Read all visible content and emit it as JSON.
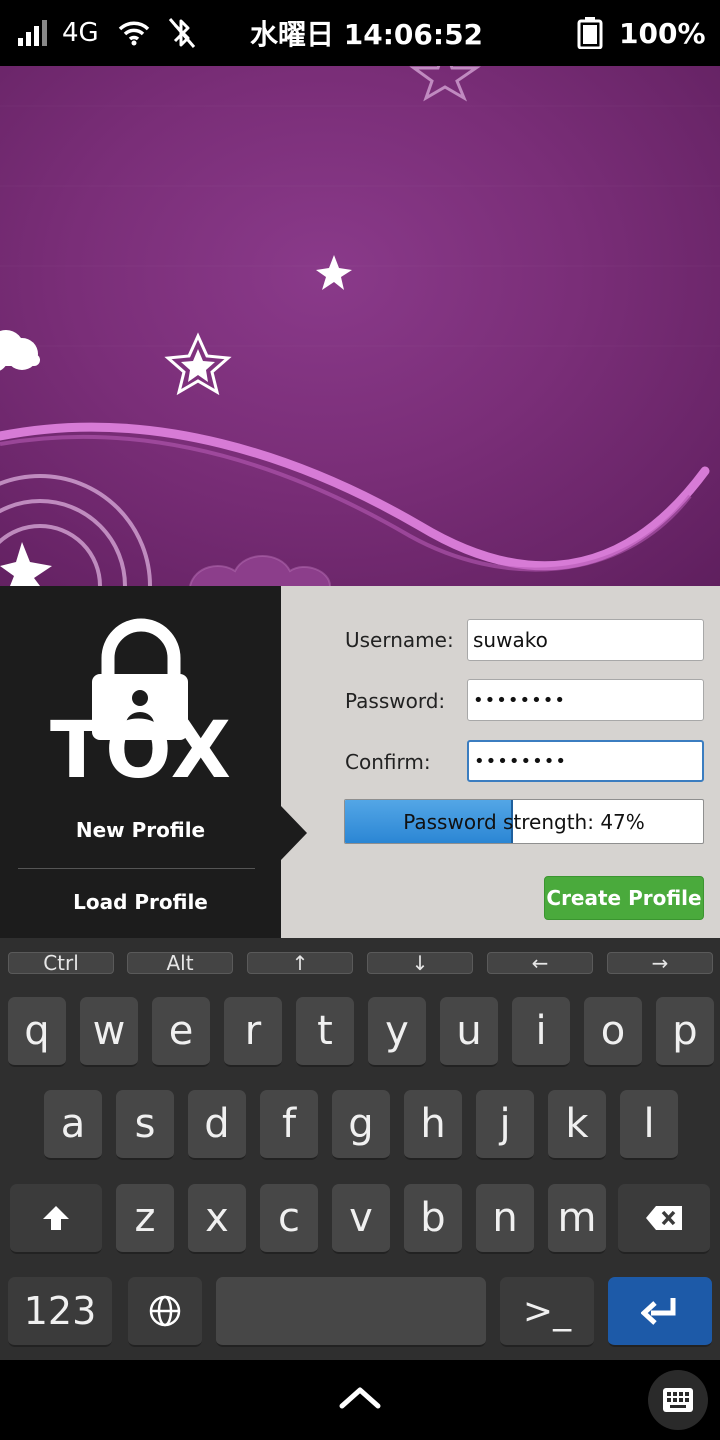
{
  "status_bar": {
    "network": "4G",
    "time": "水曜日 14:06:52",
    "battery": "100%",
    "icons": [
      "signal-icon",
      "wifi-icon",
      "bluetooth-off-icon",
      "battery-icon"
    ]
  },
  "sidebar": {
    "logo_text": "TOX",
    "new_profile": "New Profile",
    "load_profile": "Load Profile"
  },
  "form": {
    "username_label": "Username:",
    "username_value": "suwako",
    "password_label": "Password:",
    "password_value": "••••••••",
    "confirm_label": "Confirm:",
    "confirm_value": "••••••••",
    "strength_text": "Password strength: 47%",
    "strength_percent": 47,
    "create_button": "Create Profile"
  },
  "colors": {
    "accent_blue": "#2b86d4",
    "create_green": "#4aaa3c",
    "wallpaper_purple": "#7a2e78"
  },
  "keyboard": {
    "function_keys": [
      "Ctrl",
      "Alt",
      "↑",
      "↓",
      "←",
      "→"
    ],
    "row1": [
      "q",
      "w",
      "e",
      "r",
      "t",
      "y",
      "u",
      "i",
      "o",
      "p"
    ],
    "row2": [
      "a",
      "s",
      "d",
      "f",
      "g",
      "h",
      "j",
      "k",
      "l"
    ],
    "row3": [
      "z",
      "x",
      "c",
      "v",
      "b",
      "n",
      "m"
    ],
    "numbers_key": "123",
    "terminal_key": ">_"
  }
}
